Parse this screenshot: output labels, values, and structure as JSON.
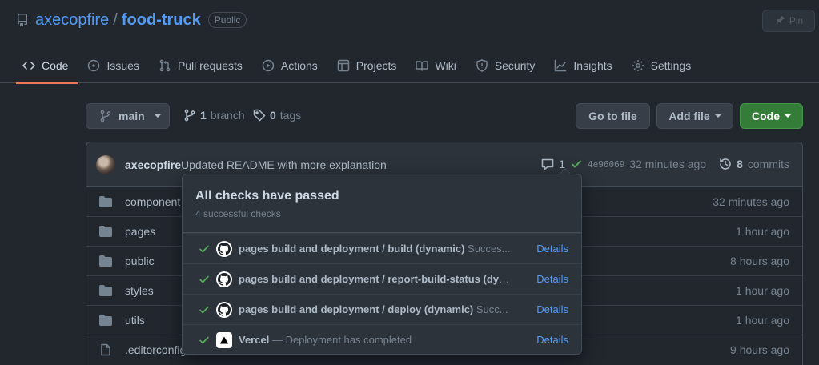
{
  "repo": {
    "owner": "axecopfire",
    "separator": "/",
    "name": "food-truck",
    "visibility": "Public",
    "pin_label": "Pin"
  },
  "tabs": [
    {
      "label": "Code",
      "icon": "code-icon",
      "active": true
    },
    {
      "label": "Issues",
      "icon": "issue-icon"
    },
    {
      "label": "Pull requests",
      "icon": "pull-request-icon"
    },
    {
      "label": "Actions",
      "icon": "play-icon"
    },
    {
      "label": "Projects",
      "icon": "table-icon"
    },
    {
      "label": "Wiki",
      "icon": "book-icon"
    },
    {
      "label": "Security",
      "icon": "shield-icon"
    },
    {
      "label": "Insights",
      "icon": "graph-icon"
    },
    {
      "label": "Settings",
      "icon": "gear-icon"
    }
  ],
  "toolbar": {
    "branch": "main",
    "branch_count": "1",
    "branch_word": "branch",
    "tag_count": "0",
    "tag_word": "tags",
    "goto_label": "Go to file",
    "add_label": "Add file",
    "code_label": "Code"
  },
  "commit": {
    "author": "axecopfire",
    "message": "Updated README with more explanation",
    "comments": "1",
    "sha": "4e96069",
    "time": "32 minutes ago",
    "commits_count": "8",
    "commits_word": "commits"
  },
  "files": [
    {
      "name": "component",
      "age": "32 minutes ago",
      "type": "folder"
    },
    {
      "name": "pages",
      "age": "1 hour ago",
      "type": "folder"
    },
    {
      "name": "public",
      "age": "8 hours ago",
      "type": "folder"
    },
    {
      "name": "styles",
      "age": "1 hour ago",
      "type": "folder"
    },
    {
      "name": "utils",
      "age": "1 hour ago",
      "type": "folder"
    },
    {
      "name": ".editorconfig",
      "age": "9 hours ago",
      "type": "file"
    }
  ],
  "checks": {
    "title": "All checks have passed",
    "subtitle": "4 successful checks",
    "items": [
      {
        "name": "pages build and deployment / build (dynamic)",
        "status": "Succes...",
        "details": "Details",
        "app": "github"
      },
      {
        "name": "pages build and deployment / report-build-status (dyn...",
        "status": "",
        "details": "Details",
        "app": "github"
      },
      {
        "name": "pages build and deployment / deploy (dynamic)",
        "status": "Succ...",
        "details": "Details",
        "app": "github"
      },
      {
        "name": "Vercel",
        "status": "— Deployment has completed",
        "details": "Details",
        "app": "vercel"
      }
    ]
  },
  "colors": {
    "background": "#22272e",
    "link": "#539bf5",
    "success": "#57ab5a",
    "primary_button": "#347d39",
    "active_tab_underline": "#ec775c"
  }
}
